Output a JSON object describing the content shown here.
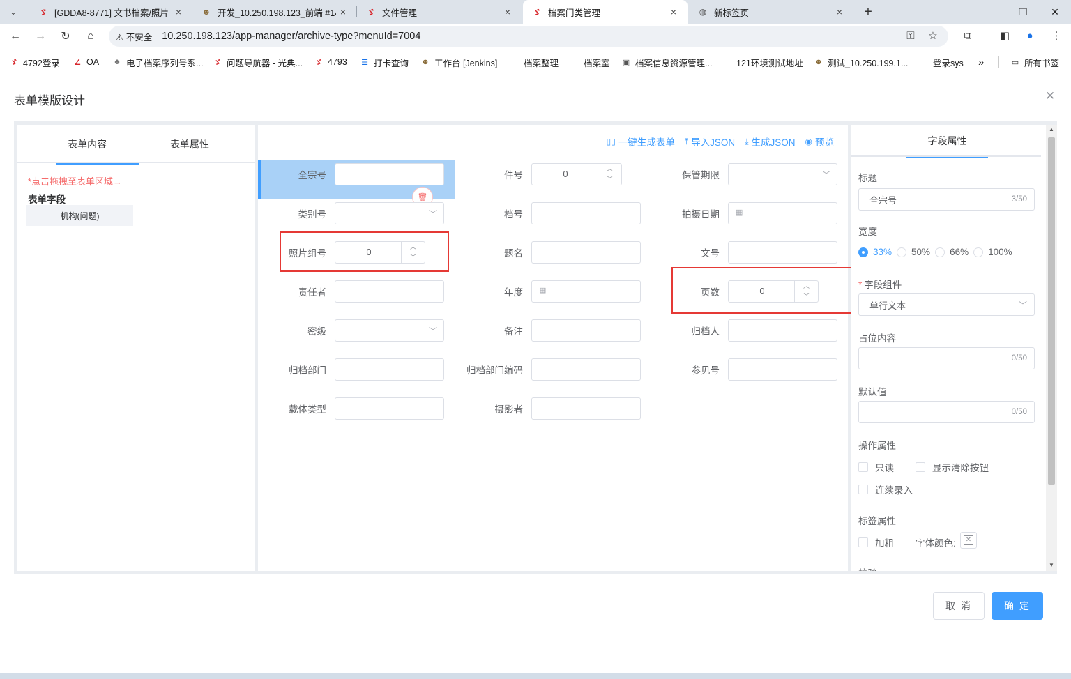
{
  "browser": {
    "tabs": [
      {
        "title": "[GDDA8-8771] 文书档案/照片",
        "icon": "yuque-icon"
      },
      {
        "title": "开发_10.250.198.123_前端 #14",
        "icon": "jenkins-icon"
      },
      {
        "title": "文件管理",
        "icon": "yuque-icon"
      },
      {
        "title": "档案门类管理",
        "icon": "yuque-icon"
      },
      {
        "title": "新标签页",
        "icon": "globe-icon"
      }
    ],
    "security_label": "不安全",
    "url": "10.250.198.123/app-manager/archive-type?menuId=7004",
    "bookmarks": [
      "4792登录",
      "OA",
      "电子档案序列号系...",
      "问题导航器 - 光典...",
      "4793",
      "打卡查询",
      "工作台 [Jenkins]",
      "档案整理",
      "档案室",
      "档案信息资源管理...",
      "121环境测试地址",
      "测试_10.250.199.1...",
      "登录sys"
    ],
    "all_bookmarks": "所有书签"
  },
  "dialog": {
    "title": "表单模版设计",
    "cancel": "取 消",
    "ok": "确 定"
  },
  "left": {
    "tab_content": "表单内容",
    "tab_props": "表单属性",
    "hint": "*点击拖拽至表单区域→",
    "section": "表单字段",
    "chip": "机构(问题)"
  },
  "toolbar": {
    "generate_form": "一键生成表单",
    "import_json": "导入JSON",
    "generate_json": "生成JSON",
    "preview": "预览"
  },
  "form": {
    "quanzonghao": "全宗号",
    "jianhao": "件号",
    "baoguanqixian": "保管期限",
    "leibiehao": "类别号",
    "danghao": "档号",
    "paisheriqi": "拍摄日期",
    "zhaopianzuhao": "照片组号",
    "timing": "题名",
    "wenhao": "文号",
    "zerenzhe": "责任者",
    "niandu": "年度",
    "yeshu": "页数",
    "miji": "密级",
    "beizhu": "备注",
    "guidangren": "归档人",
    "guidangbumen": "归档部门",
    "guidangbumenbianma": "归档部门编码",
    "canjianhao": "参见号",
    "zaitileixing": "载体类型",
    "sheyingzhe": "摄影者",
    "num_default": "0"
  },
  "right": {
    "tab": "字段属性",
    "title_label": "标题",
    "title_value": "全宗号",
    "title_count": "3/50",
    "width_label": "宽度",
    "widths": [
      "33%",
      "50%",
      "66%",
      "100%"
    ],
    "component_label": "字段组件",
    "component_value": "单行文本",
    "placeholder_label": "占位内容",
    "placeholder_count": "0/50",
    "default_label": "默认值",
    "default_count": "0/50",
    "op_label": "操作属性",
    "readonly": "只读",
    "show_clear": "显示清除按钮",
    "continuous": "连续录入",
    "label_props": "标签属性",
    "bold": "加粗",
    "font_color": "字体颜色:",
    "validate": "校验"
  }
}
